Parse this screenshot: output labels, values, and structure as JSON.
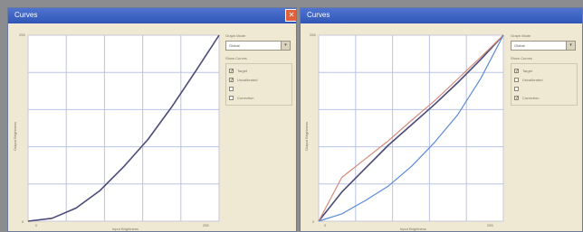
{
  "windows": [
    {
      "id": "left",
      "title": "Curves",
      "y_axis_label": "Output Brightness",
      "x_axis_label": "Input Brightness",
      "tick_min": "0",
      "tick_max": "255",
      "graph_mode_label": "Graph Mode",
      "graph_mode_value": "Global",
      "show_curves_label": "Show Curves",
      "options": [
        {
          "label": "Target",
          "checked": true
        },
        {
          "label": "Uncalibrated",
          "checked": true
        },
        {
          "label": "",
          "checked": false
        },
        {
          "label": "Correction",
          "checked": false
        }
      ]
    },
    {
      "id": "right",
      "title": "Curves",
      "y_axis_label": "Output Brightness",
      "x_axis_label": "Input Brightness",
      "tick_min": "0",
      "tick_max": "255",
      "graph_mode_label": "Graph Mode",
      "graph_mode_value": "Global",
      "show_curves_label": "Show Curves",
      "options": [
        {
          "label": "Target",
          "checked": true
        },
        {
          "label": "Uncalibrated",
          "checked": false
        },
        {
          "label": "",
          "checked": false
        },
        {
          "label": "Correction",
          "checked": true
        }
      ]
    }
  ],
  "colors": {
    "target": "#4a4a7a",
    "uncalibrated": "#d58a7a",
    "correction": "#5a8ad6"
  },
  "chart_data": [
    {
      "type": "line",
      "x_range": [
        0,
        255
      ],
      "y_range": [
        0,
        255
      ],
      "grid": true,
      "series": [
        {
          "x": [
            0,
            32,
            64,
            96,
            128,
            160,
            192,
            224,
            255
          ],
          "y": [
            0,
            4,
            18,
            42,
            75,
            112,
            157,
            206,
            255
          ]
        }
      ]
    },
    {
      "type": "line",
      "x_range": [
        0,
        255
      ],
      "y_range": [
        0,
        255
      ],
      "grid": true,
      "series": [
        {
          "x": [
            0,
            32,
            64,
            96,
            128,
            160,
            192,
            224,
            255
          ],
          "y": [
            0,
            40,
            72,
            104,
            132,
            160,
            190,
            222,
            255
          ]
        },
        {
          "x": [
            0,
            32,
            64,
            96,
            128,
            160,
            192,
            224,
            255
          ],
          "y": [
            0,
            60,
            85,
            110,
            138,
            165,
            195,
            225,
            255
          ]
        },
        {
          "x": [
            0,
            32,
            64,
            96,
            128,
            160,
            192,
            224,
            255
          ],
          "y": [
            0,
            10,
            28,
            48,
            75,
            108,
            146,
            196,
            255
          ]
        }
      ]
    }
  ]
}
